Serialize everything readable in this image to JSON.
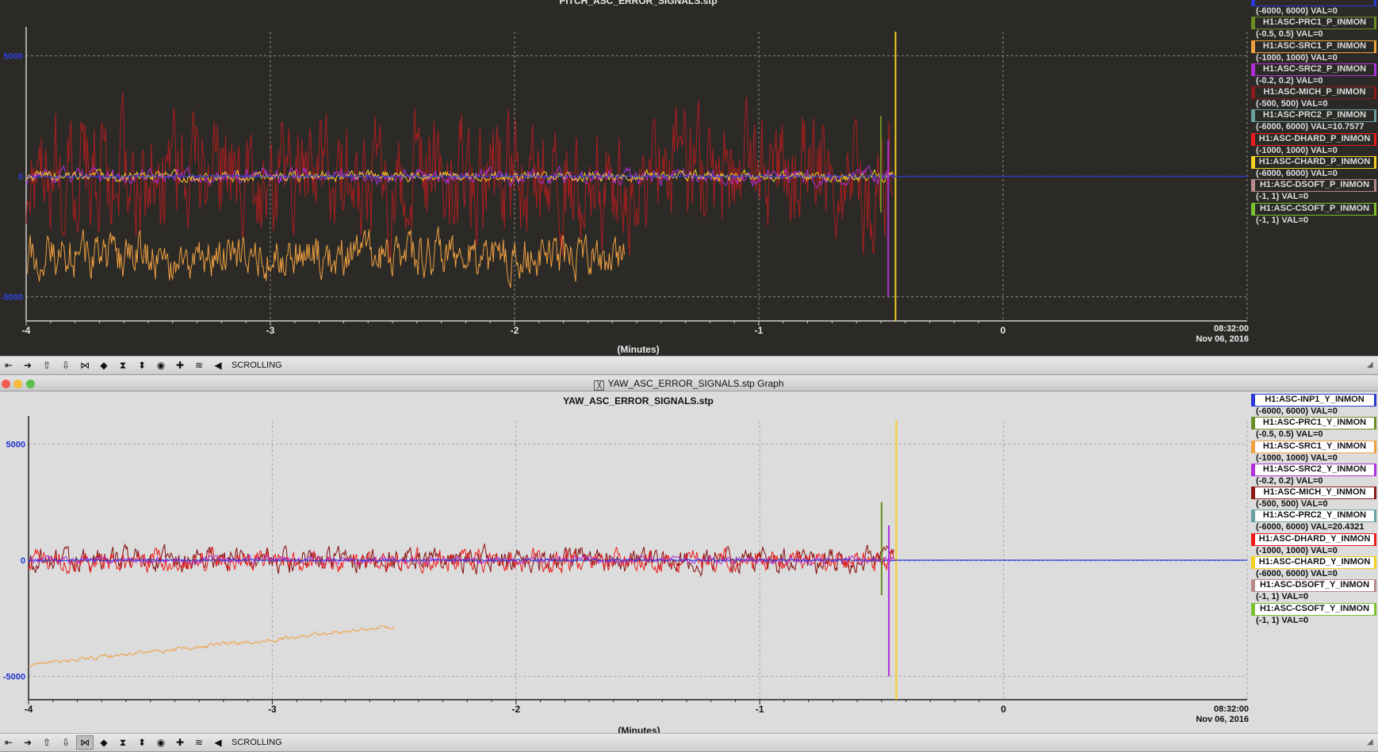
{
  "top_graph": {
    "title": "PITCH_ASC_ERROR_SIGNALS.stp",
    "y_ticks": [
      "5000",
      "0",
      "-5000"
    ],
    "x_ticks": [
      "-4",
      "-3",
      "-2",
      "-1",
      "0"
    ],
    "x_axis_label": "(Minutes)",
    "time_end": "08:32:00",
    "date_end": "Nov 06, 2016",
    "legend": [
      {
        "name": "",
        "range": "(-6000, 6000) VAL=0",
        "color": "#2a3ad6"
      },
      {
        "name": "H1:ASC-PRC1_P_INMON",
        "range": "(-0.5, 0.5) VAL=0",
        "color": "#6b8e23"
      },
      {
        "name": "H1:ASC-SRC1_P_INMON",
        "range": "(-1000, 1000) VAL=0",
        "color": "#f0a040"
      },
      {
        "name": "H1:ASC-SRC2_P_INMON",
        "range": "(-0.2, 0.2) VAL=0",
        "color": "#b030d8"
      },
      {
        "name": "H1:ASC-MICH_P_INMON",
        "range": "(-500, 500) VAL=0",
        "color": "#8b1a1a"
      },
      {
        "name": "H1:ASC-PRC2_P_INMON",
        "range": "(-6000, 6000) VAL=10.7577",
        "color": "#6aa0a0"
      },
      {
        "name": "H1:ASC-DHARD_P_INMON",
        "range": "(-1000, 1000) VAL=0",
        "color": "#ee1c1c"
      },
      {
        "name": "H1:ASC-CHARD_P_INMON",
        "range": "(-6000, 6000) VAL=0",
        "color": "#f5d020"
      },
      {
        "name": "H1:ASC-DSOFT_P_INMON",
        "range": "(-1, 1) VAL=0",
        "color": "#b88a8a"
      },
      {
        "name": "H1:ASC-CSOFT_P_INMON",
        "range": "(-1, 1) VAL=0",
        "color": "#7cc030"
      }
    ]
  },
  "bottom_window": {
    "window_title": "YAW_ASC_ERROR_SIGNALS.stp Graph",
    "title": "YAW_ASC_ERROR_SIGNALS.stp",
    "y_ticks": [
      "5000",
      "0",
      "-5000"
    ],
    "x_ticks": [
      "-4",
      "-3",
      "-2",
      "-1",
      "0"
    ],
    "x_axis_label": "(Minutes)",
    "time_end": "08:32:00",
    "date_end": "Nov 06, 2016",
    "legend": [
      {
        "name": "H1:ASC-INP1_Y_INMON",
        "range": "(-6000, 6000) VAL=0",
        "color": "#2a3ad6"
      },
      {
        "name": "H1:ASC-PRC1_Y_INMON",
        "range": "(-0.5, 0.5) VAL=0",
        "color": "#6b8e23"
      },
      {
        "name": "H1:ASC-SRC1_Y_INMON",
        "range": "(-1000, 1000) VAL=0",
        "color": "#f0a040"
      },
      {
        "name": "H1:ASC-SRC2_Y_INMON",
        "range": "(-0.2, 0.2) VAL=0",
        "color": "#b030d8"
      },
      {
        "name": "H1:ASC-MICH_Y_INMON",
        "range": "(-500, 500) VAL=0",
        "color": "#8b1a1a"
      },
      {
        "name": "H1:ASC-PRC2_Y_INMON",
        "range": "(-6000, 6000) VAL=20.4321",
        "color": "#6aa0a0"
      },
      {
        "name": "H1:ASC-DHARD_Y_INMON",
        "range": "(-1000, 1000) VAL=0",
        "color": "#ee1c1c"
      },
      {
        "name": "H1:ASC-CHARD_Y_INMON",
        "range": "(-6000, 6000) VAL=0",
        "color": "#f5d020"
      },
      {
        "name": "H1:ASC-DSOFT_Y_INMON",
        "range": "(-1, 1) VAL=0",
        "color": "#b88a8a"
      },
      {
        "name": "H1:ASC-CSOFT_Y_INMON",
        "range": "(-1, 1) VAL=0",
        "color": "#7cc030"
      }
    ]
  },
  "toolbar": {
    "mode_label": "SCROLLING",
    "buttons": [
      "scroll-left-icon",
      "scroll-right-icon",
      "scroll-up-icon",
      "scroll-down-icon",
      "zoom-x-in-icon",
      "zoom-x-out-icon",
      "zoom-y-in-icon",
      "zoom-y-out-icon",
      "target-icon",
      "add-icon",
      "autoscale-icon",
      "rewind-icon"
    ]
  },
  "chart_data": [
    {
      "type": "line",
      "title": "PITCH_ASC_ERROR_SIGNALS.stp",
      "xlabel": "(Minutes)",
      "xlim": [
        -4,
        1.0
      ],
      "ylim": [
        -6000,
        6000
      ],
      "y_ticks": [
        5000,
        0,
        -5000
      ],
      "grid": true,
      "legend_position": "right",
      "series": [
        {
          "name": "H1:ASC-MICH_P_INMON",
          "color": "#a11f1f",
          "amplitude": 2500,
          "offset": 0,
          "end_x": -0.45
        },
        {
          "name": "H1:ASC-SRC1_P_INMON",
          "color": "#f0a040",
          "amplitude": 900,
          "offset": -3300,
          "end_x": -1.55
        },
        {
          "name": "H1:ASC-SRC2_P_INMON",
          "color": "#b030d8",
          "amplitude": 300,
          "offset": 0,
          "end_x": -0.45
        },
        {
          "name": "H1:ASC-CHARD_P_INMON",
          "color": "#f5d020",
          "amplitude": 200,
          "offset": 0,
          "end_x": -0.45
        },
        {
          "name": "",
          "color": "#2a3ad6",
          "amplitude": 100,
          "offset": 0,
          "end_x": 1.0
        }
      ]
    },
    {
      "type": "line",
      "title": "YAW_ASC_ERROR_SIGNALS.stp",
      "xlabel": "(Minutes)",
      "xlim": [
        -4,
        1.0
      ],
      "ylim": [
        -6000,
        6000
      ],
      "y_ticks": [
        5000,
        0,
        -5000
      ],
      "grid": true,
      "legend_position": "right",
      "series": [
        {
          "name": "H1:ASC-MICH_Y_INMON",
          "color": "#8b1a1a",
          "amplitude": 500,
          "offset": 0,
          "end_x": -0.45
        },
        {
          "name": "H1:ASC-DHARD_Y_INMON",
          "color": "#ee1c1c",
          "amplitude": 450,
          "offset": 0,
          "end_x": -0.45
        },
        {
          "name": "H1:ASC-SRC1_Y_INMON",
          "color": "#f0a040",
          "amplitude": 150,
          "offset": -4500,
          "end_x": -2.5
        },
        {
          "name": "H1:ASC-SRC2_Y_INMON",
          "color": "#b030d8",
          "amplitude": 150,
          "offset": 0,
          "end_x": -0.45
        },
        {
          "name": "H1:ASC-INP1_Y_INMON",
          "color": "#2a3ad6",
          "amplitude": 80,
          "offset": 0,
          "end_x": 1.0
        }
      ]
    }
  ]
}
